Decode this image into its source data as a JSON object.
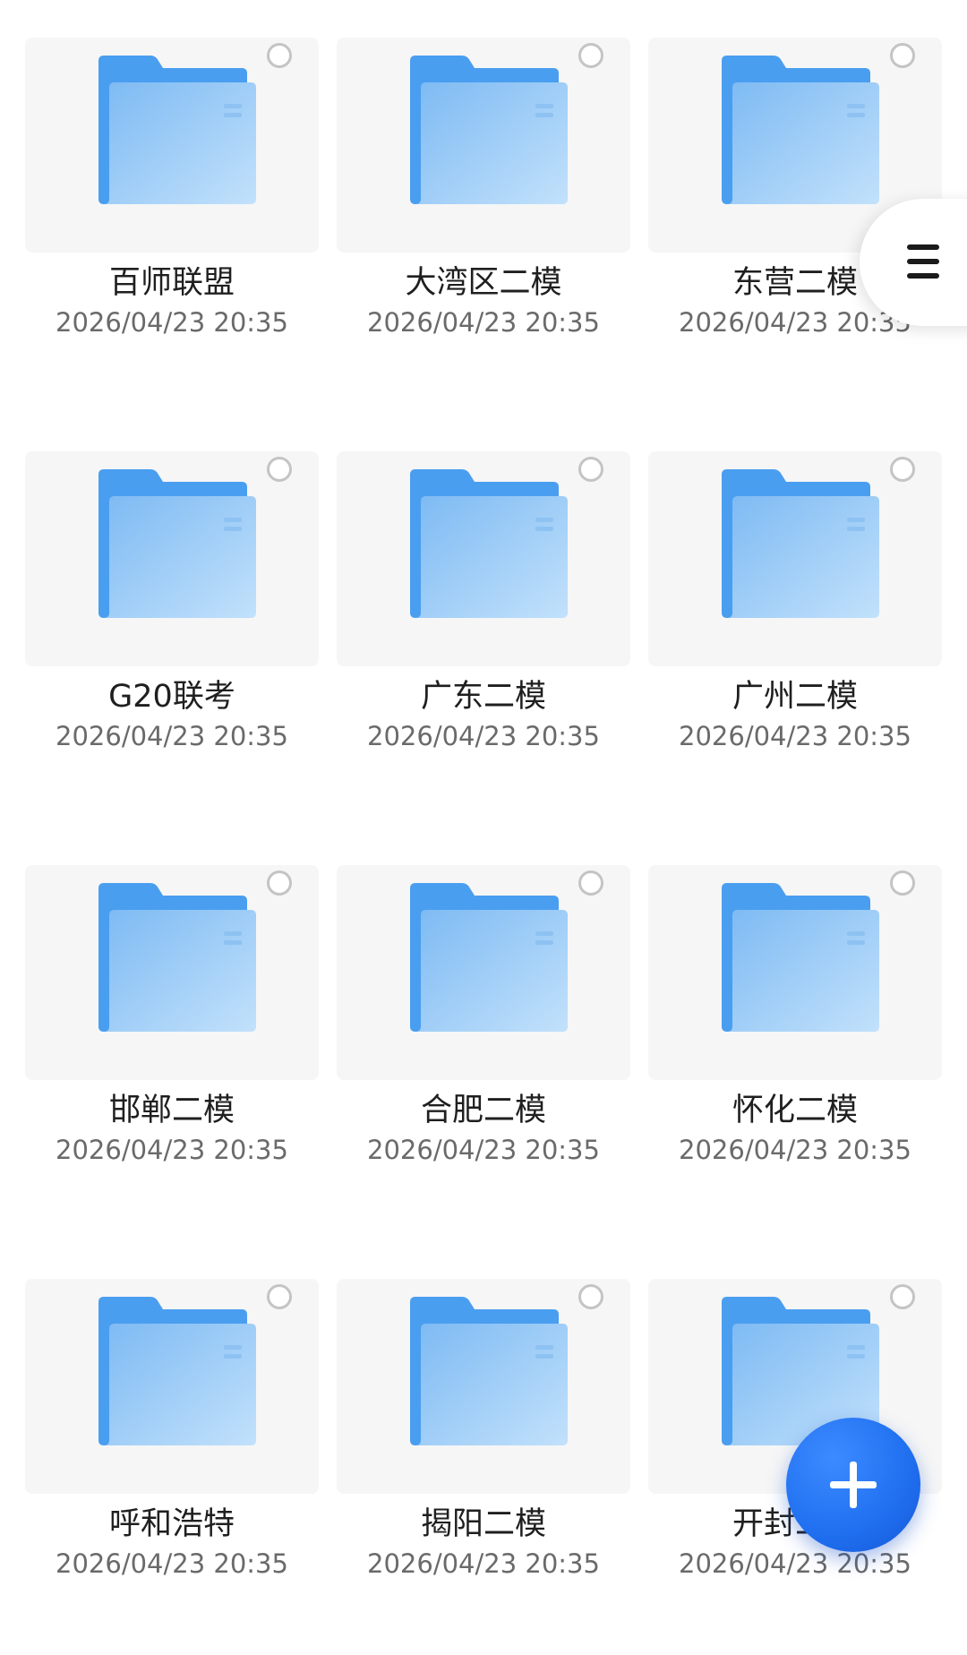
{
  "folders": [
    {
      "name": "百师联盟",
      "date": "2026/04/23 20:35"
    },
    {
      "name": "大湾区二模",
      "date": "2026/04/23 20:35"
    },
    {
      "name": "东营二模",
      "date": "2026/04/23 20:35"
    },
    {
      "name": "G20联考",
      "date": "2026/04/23 20:35"
    },
    {
      "name": "广东二模",
      "date": "2026/04/23 20:35"
    },
    {
      "name": "广州二模",
      "date": "2026/04/23 20:35"
    },
    {
      "name": "邯郸二模",
      "date": "2026/04/23 20:35"
    },
    {
      "name": "合肥二模",
      "date": "2026/04/23 20:35"
    },
    {
      "name": "怀化二模",
      "date": "2026/04/23 20:35"
    },
    {
      "name": "呼和浩特",
      "date": "2026/04/23 20:35"
    },
    {
      "name": "揭阳二模",
      "date": "2026/04/23 20:35"
    },
    {
      "name": "开封二模",
      "date": "2026/04/23 20:35"
    }
  ],
  "icons": {
    "folder": "folder-icon",
    "select": "selection-circle-icon",
    "menu": "menu-icon",
    "add": "plus-icon"
  },
  "colors": {
    "folder_back": "#4a9ef0",
    "folder_front_light": "#bfe0fb",
    "folder_front_dark": "#7dbaf3",
    "fab": "#1f6ff0"
  }
}
